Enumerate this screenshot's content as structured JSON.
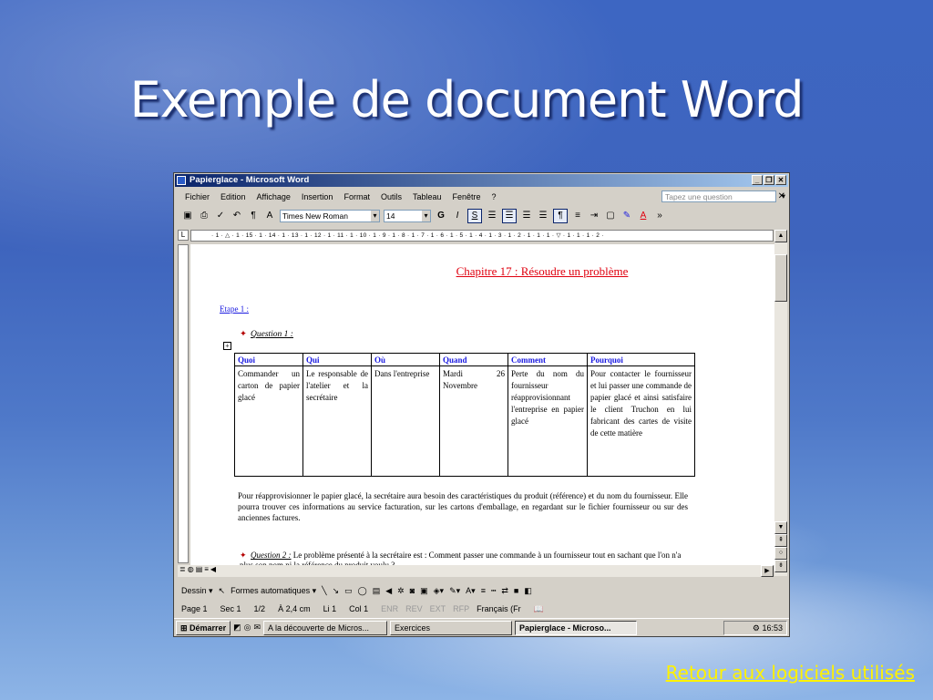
{
  "slide": {
    "title": "Exemple de document Word",
    "footer_link": "Retour aux logiciels utilisés"
  },
  "window": {
    "title": "Papierglace - Microsoft Word",
    "menus": [
      "Fichier",
      "Edition",
      "Affichage",
      "Insertion",
      "Format",
      "Outils",
      "Tableau",
      "Fenêtre",
      "?"
    ],
    "ask_placeholder": "Tapez une question",
    "font_name": "Times New Roman",
    "font_size": "14",
    "ruler": "· 1 · △ · 1 · 15 · 1 · 14 · 1 · 13 · 1 · 12 · 1 · 11 · 1 · 10 · 1 · 9 · 1 · 8 · 1 · 7 · 1 · 6 · 1 · 5 · 1 · 4 · 1 · 3 · 1 · 2 · 1 · 1 · 1 · ▽ · 1 · 1 · 1 · 2 ·"
  },
  "document": {
    "chapter": "Chapitre 17 : Résoudre un problème",
    "etape": "Etape 1 :",
    "question1": "Question 1 :",
    "table": {
      "headers": [
        "Quoi",
        "Qui",
        "Où",
        "Quand",
        "Comment",
        "Pourquoi"
      ],
      "row": [
        "Commander un carton de papier glacé",
        "Le responsable de l'atelier et la secrétaire",
        "Dans l'entreprise",
        "Mardi 26 Novembre",
        "Perte du nom du fournisseur réapprovisionnant l'entreprise en papier glacé",
        "Pour contacter le fournisseur et lui passer une commande de papier glacé et ainsi satisfaire le client Truchon en lui fabricant des cartes de visite de cette matière"
      ]
    },
    "paragraph": "Pour réapprovisionner le papier glacé, la secrétaire aura besoin des caractéristiques du produit (référence) et du nom du fournisseur. Elle pourra trouver ces informations au service facturation, sur les cartons d'emballage, en regardant sur le fichier fournisseur ou sur des anciennes factures.",
    "question2_label": "Question 2 :",
    "question2_text": "Le problème présenté à la secrétaire est : Comment passer une commande à un fournisseur tout en sachant que l'on n'a plus son nom ni la référence du produit voulu ?"
  },
  "drawing_toolbar": {
    "dessin": "Dessin ▾",
    "formes": "Formes automatiques ▾"
  },
  "status": {
    "page": "Page 1",
    "sec": "Sec 1",
    "pages": "1/2",
    "pos": "À 2,4 cm",
    "line": "Li 1",
    "col": "Col 1",
    "modes": [
      "ENR",
      "REV",
      "EXT",
      "RFP"
    ],
    "lang": "Français (Fr"
  },
  "taskbar": {
    "start": "Démarrer",
    "tasks": [
      "A la découverte de Micros...",
      "Exercices",
      "Papierglace - Microso..."
    ],
    "clock": "16:53"
  }
}
